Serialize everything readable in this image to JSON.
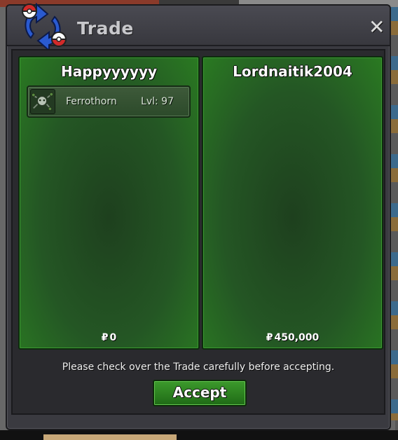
{
  "window": {
    "title": "Trade"
  },
  "trade": {
    "left": {
      "player_name": "Happyyyyyy",
      "items": [
        {
          "name": "Ferrothorn",
          "level": "Lvl: 97",
          "icon": "ferrothorn-sprite-icon"
        }
      ],
      "money": "0"
    },
    "right": {
      "player_name": "Lordnaitik2004",
      "items": [],
      "money": "450,000"
    },
    "currency_symbol": "₽"
  },
  "footer": {
    "notice": "Please check over the Trade carefully before accepting.",
    "accept_label": "Accept"
  },
  "colors": {
    "panel_green": "#2a7a22",
    "accept_green": "#3c9a2c",
    "window_bg": "#3a3a40"
  }
}
